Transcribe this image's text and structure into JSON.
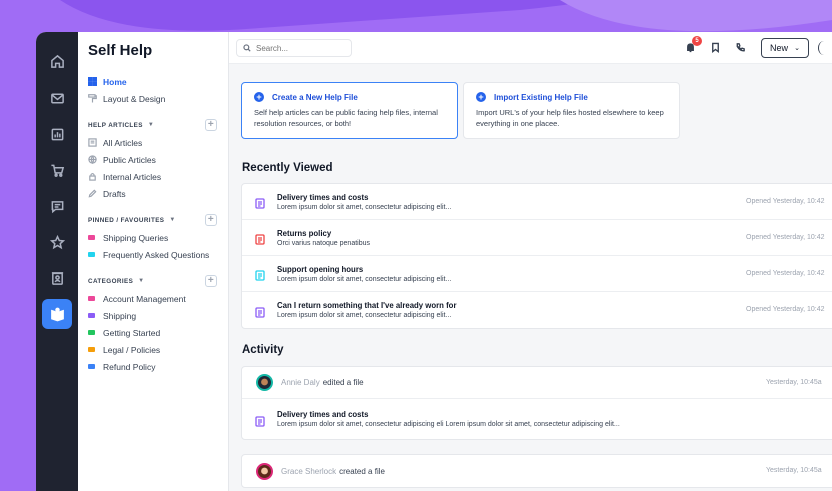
{
  "colors": {
    "accent": "#2563eb",
    "background": "#a06cf5",
    "rail": "#1f2330"
  },
  "rail": {
    "items": [
      {
        "name": "home-icon"
      },
      {
        "name": "mail-icon"
      },
      {
        "name": "chart-icon"
      },
      {
        "name": "cart-icon"
      },
      {
        "name": "chat-icon"
      },
      {
        "name": "star-icon"
      },
      {
        "name": "contacts-icon"
      },
      {
        "name": "book-icon",
        "active": true
      }
    ]
  },
  "nav": {
    "title": "Self Help",
    "top_items": [
      {
        "label": "Home",
        "icon": "grid-icon",
        "active": true
      },
      {
        "label": "Layout & Design",
        "icon": "paint-roller-icon"
      }
    ],
    "help_articles": {
      "heading": "HELP ARTICLES",
      "items": [
        {
          "label": "All Articles",
          "icon": "files-icon"
        },
        {
          "label": "Public Articles",
          "icon": "globe-icon"
        },
        {
          "label": "Internal Articles",
          "icon": "lock-icon"
        },
        {
          "label": "Drafts",
          "icon": "pencil-icon"
        }
      ]
    },
    "pinned": {
      "heading": "PINNED / FAVOURITES",
      "items": [
        {
          "label": "Shipping Queries",
          "color": "#ec4899"
        },
        {
          "label": "Frequently Asked Questions",
          "color": "#22d3ee"
        }
      ]
    },
    "categories": {
      "heading": "CATEGORIES",
      "items": [
        {
          "label": "Account Management",
          "color": "#ec4899"
        },
        {
          "label": "Shipping",
          "color": "#8b5cf6"
        },
        {
          "label": "Getting Started",
          "color": "#22c55e"
        },
        {
          "label": "Legal / Policies",
          "color": "#f59e0b"
        },
        {
          "label": "Refund Policy",
          "color": "#3b82f6"
        }
      ]
    }
  },
  "topbar": {
    "search_placeholder": "Search...",
    "notification_count": "5",
    "new_label": "New"
  },
  "cards": [
    {
      "title": "Create a New Help File",
      "text": "Self help articles can be public facing help files, internal resolution resources, or both!"
    },
    {
      "title": "Import Existing Help File",
      "text": "Import URL's of your help files hosted elsewhere to keep everything in one placee."
    }
  ],
  "recently_viewed": {
    "heading": "Recently Viewed",
    "rows": [
      {
        "title": "Delivery times and costs",
        "subtitle": "Lorem ipsum dolor sit amet, consectetur adipiscing elit...",
        "time": "Opened Yesterday, 10:42",
        "color": "#8b5cf6"
      },
      {
        "title": "Returns policy",
        "subtitle": "Orci varius natoque penatibus",
        "time": "Opened Yesterday, 10:42",
        "color": "#ef4444"
      },
      {
        "title": "Support opening hours",
        "subtitle": "Lorem ipsum dolor sit amet, consectetur adipiscing elit...",
        "time": "Opened Yesterday, 10:42",
        "color": "#22d3ee"
      },
      {
        "title": "Can I return something that I've already worn for",
        "subtitle": "Lorem ipsum dolor sit amet, consectetur adipiscing elit...",
        "time": "Opened Yesterday, 10:42",
        "color": "#8b5cf6"
      }
    ]
  },
  "activity": {
    "heading": "Activity",
    "entries": [
      {
        "user": "Annie Daly",
        "action": "edited a file",
        "time": "Yesterday, 10:45a",
        "file_title": "Delivery times and costs",
        "file_subtitle": "Lorem ipsum dolor sit amet, consectetur adipiscing eli Lorem ipsum dolor sit amet, consectetur adipiscing elit..."
      },
      {
        "user": "Grace Sherlock",
        "action": "created a file",
        "time": "Yesterday, 10:45a"
      }
    ]
  }
}
